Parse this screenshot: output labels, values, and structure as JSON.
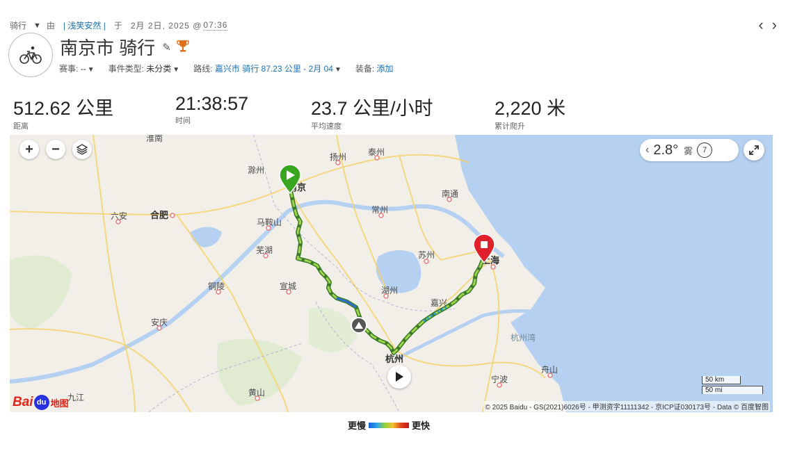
{
  "activity": {
    "type_label": "骑行",
    "by_label": "由",
    "user": "| 浅笑安然 |",
    "on_label": "于",
    "date": "2月 2日, 2025 @",
    "time": "07:36",
    "title": "南京市 骑行"
  },
  "meta": {
    "event_label": "赛事:",
    "event_value": "--",
    "event_type_label": "事件类型:",
    "event_type_value": "未分类",
    "course_label": "路线:",
    "course_value": "嘉兴市 骑行 87.23 公里 - 2月 04",
    "gear_label": "装备:",
    "gear_value": "添加"
  },
  "stats": [
    {
      "value": "512.62 公里",
      "label": "距离"
    },
    {
      "value": "21:38:57",
      "label": "时间"
    },
    {
      "value": "23.7 公里/小时",
      "label": "平均速度"
    },
    {
      "value": "2,220 米",
      "label": "累计爬升"
    }
  ],
  "map": {
    "weather_temp": "2.8°",
    "weather_condition": "雾",
    "wind_speed": "7",
    "scale_km": "50 km",
    "scale_mi": "50 mi",
    "copyright": "© 2025 Baidu - GS(2021)6026号 - 甲测资字11111342 - 京ICP证030173号 - Data © 百度智图",
    "brand_bai": "Bai",
    "brand_du": "du",
    "brand_map": "地图",
    "cities": [
      "淮南",
      "扬州",
      "泰州",
      "滁州",
      "南京",
      "南通",
      "六安",
      "合肥",
      "马鞍山",
      "常州",
      "芜湖",
      "苏州",
      "上海",
      "铜陵",
      "宣城",
      "湖州",
      "嘉兴",
      "安庆",
      "杭州湾",
      "杭州",
      "舟山",
      "宁波",
      "黄山",
      "九江"
    ]
  },
  "legend": {
    "slow": "更慢",
    "fast": "更快"
  },
  "icons": {
    "accent": "#1a6fb5",
    "start_marker_color": "#3aa51f",
    "end_marker_color": "#e0202a",
    "trophy_color": "#e0701a"
  }
}
